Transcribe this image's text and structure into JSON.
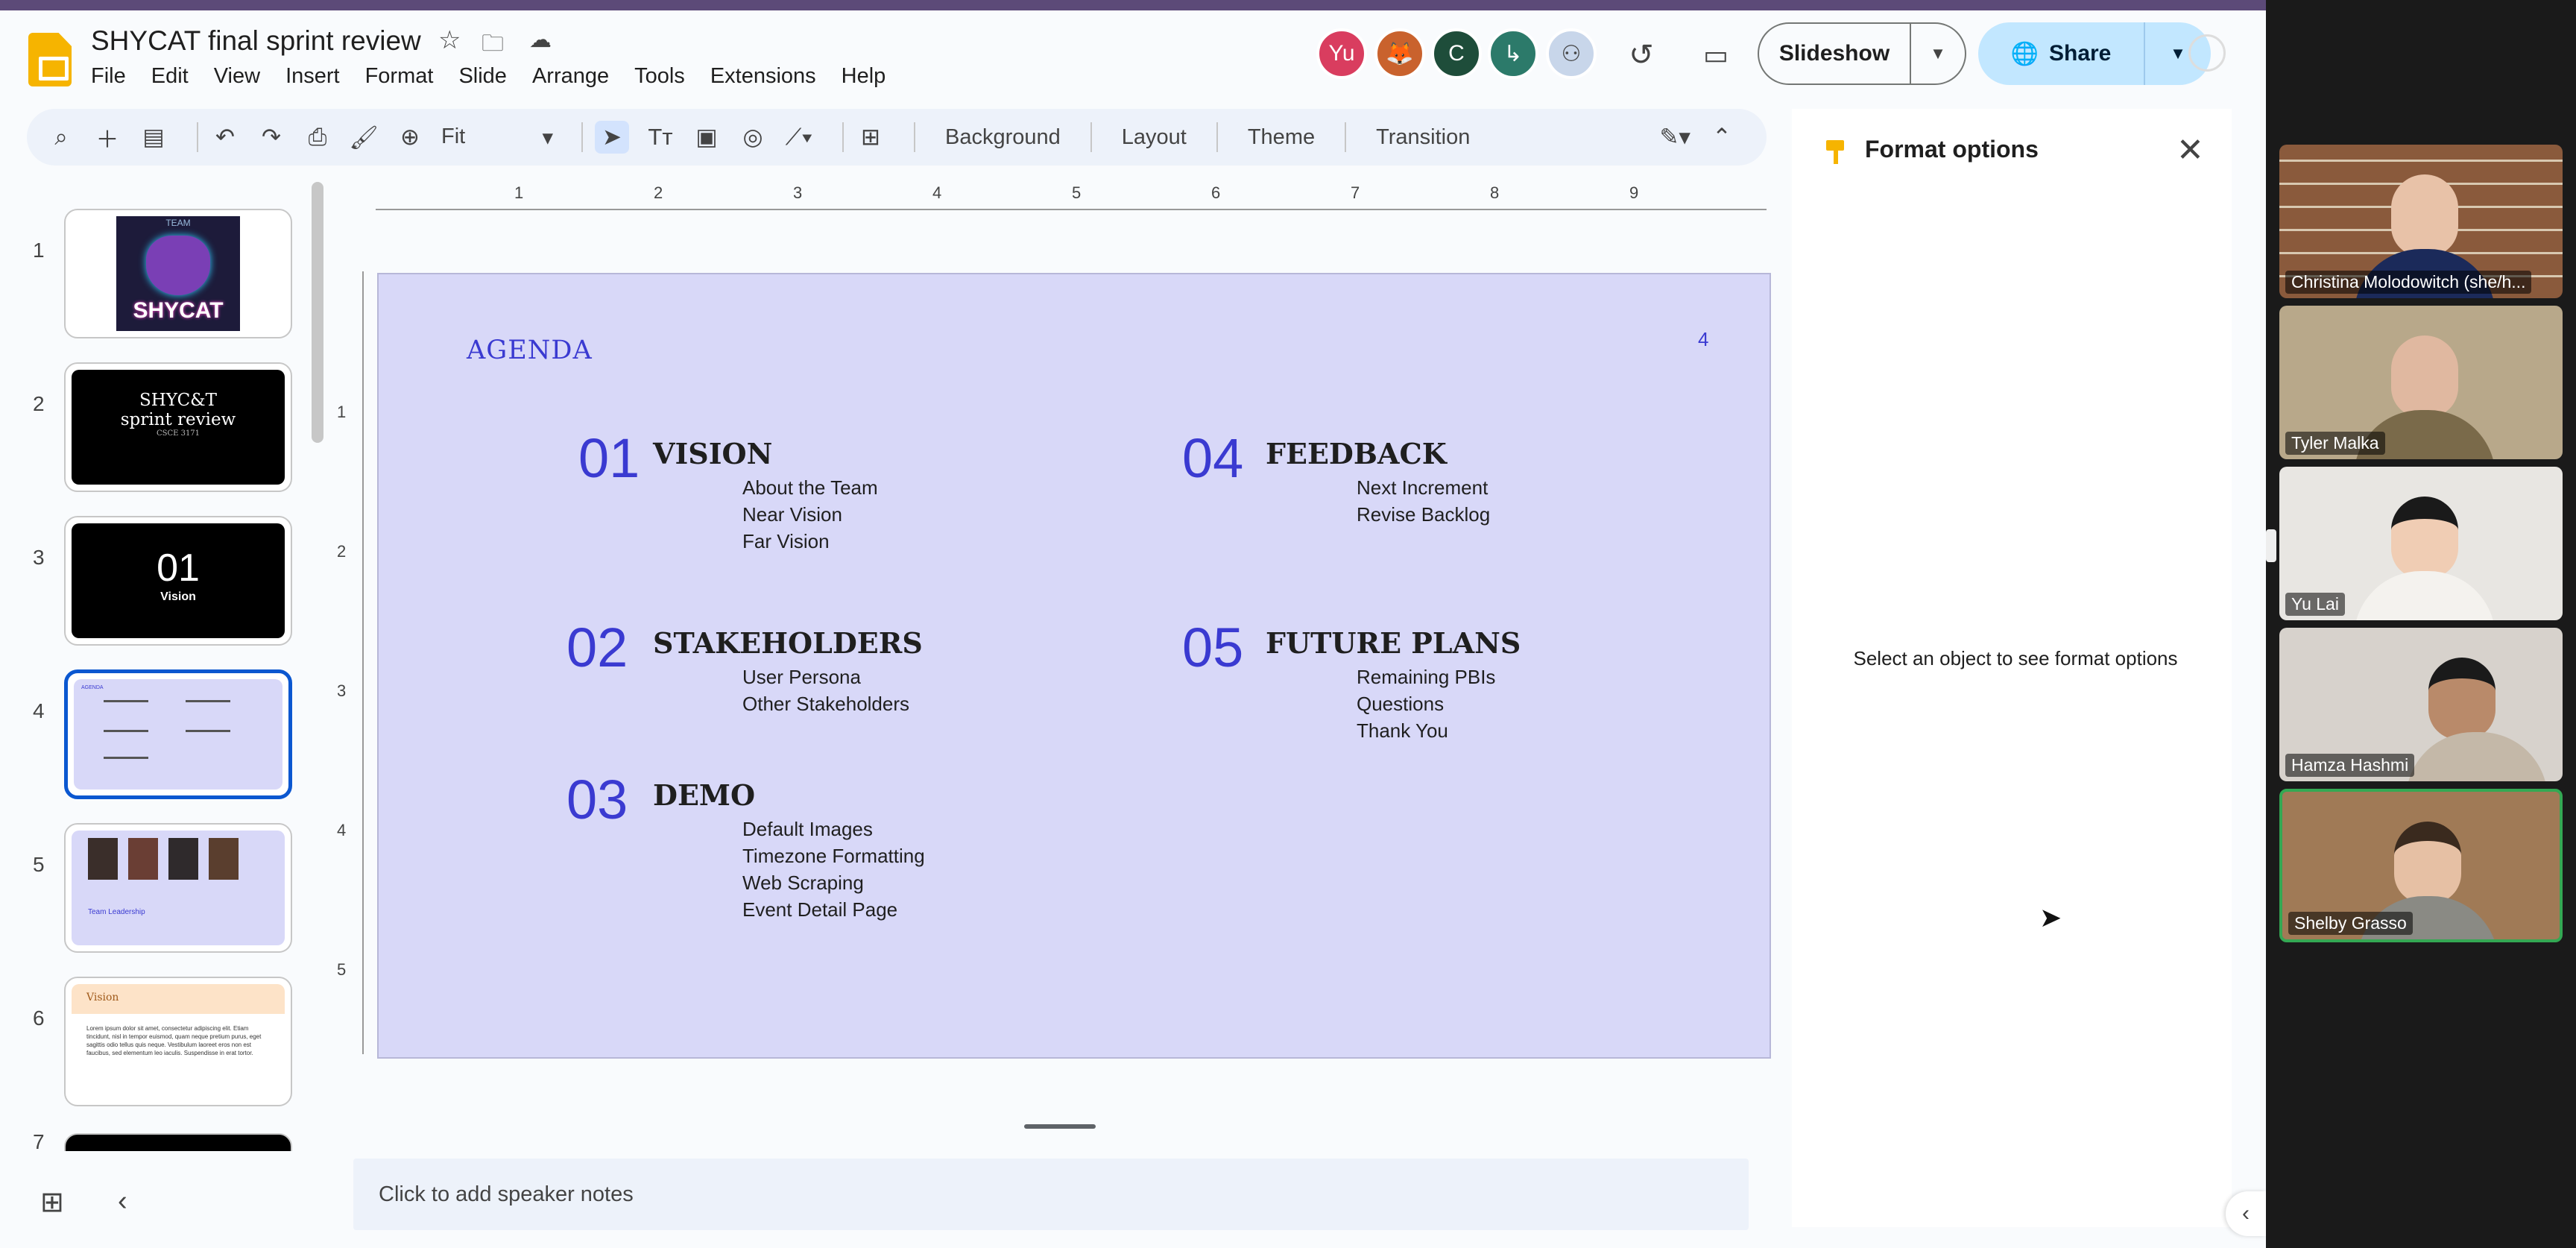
{
  "doc": {
    "title": "SHYCAT final sprint review",
    "menu": [
      "File",
      "Edit",
      "View",
      "Insert",
      "Format",
      "Slide",
      "Arrange",
      "Tools",
      "Extensions",
      "Help"
    ]
  },
  "header": {
    "collaborators": [
      {
        "initials": "Yu",
        "color": "#d93d5f"
      },
      {
        "initials": "",
        "color": "#c9622d"
      },
      {
        "initials": "C",
        "color": "#1e4d3a"
      },
      {
        "initials": "",
        "color": "#2c7a6a"
      },
      {
        "initials": "",
        "color": "#8aa7c9"
      }
    ],
    "slideshow_label": "Slideshow",
    "share_label": "Share"
  },
  "toolbar": {
    "zoom": "Fit",
    "background": "Background",
    "layout": "Layout",
    "theme": "Theme",
    "transition": "Transition"
  },
  "filmstrip": {
    "numbers": [
      "1",
      "2",
      "3",
      "4",
      "5",
      "6",
      "7"
    ],
    "slide1_team": "TEAM",
    "slide1_title": "SHYCAT",
    "slide2_title": "SHYC&T",
    "slide2_subtitle": "sprint review",
    "slide2_course": "CSCE 3171",
    "slide3_num": "01",
    "slide3_label": "Vision",
    "slide5_label": "Team Leadership",
    "slide6_title": "Vision",
    "slide6_body": "Lorem ipsum dolor sit amet, consectetur adipiscing elit. Etiam tincidunt, nisl in tempor euismod, quam neque pretium purus, eget sagittis odio tellus quis neque. Vestibulum laoreet eros non est faucibus, sed elementum leo iaculis. Suspendisse in erat tortor."
  },
  "ruler": {
    "h": [
      "1",
      "2",
      "3",
      "4",
      "5",
      "6",
      "7",
      "8",
      "9"
    ],
    "v": [
      "1",
      "2",
      "3",
      "4",
      "5"
    ]
  },
  "slide": {
    "heading": "AGENDA",
    "page_number": "4",
    "sections": [
      {
        "num": "01",
        "title": "VISION",
        "items": [
          "About the Team",
          "Near Vision",
          "Far Vision"
        ]
      },
      {
        "num": "02",
        "title": "STAKEHOLDERS",
        "items": [
          "User Persona",
          "Other Stakeholders"
        ]
      },
      {
        "num": "03",
        "title": "DEMO",
        "items": [
          "Default Images",
          "Timezone Formatting",
          "Web Scraping",
          "Event Detail Page"
        ]
      },
      {
        "num": "04",
        "title": "FEEDBACK",
        "items": [
          "Next Increment",
          "Revise Backlog"
        ]
      },
      {
        "num": "05",
        "title": "FUTURE PLANS",
        "items": [
          "Remaining PBIs",
          "Questions",
          "Thank You"
        ]
      }
    ]
  },
  "notes": {
    "placeholder": "Click to add speaker notes"
  },
  "format_panel": {
    "title": "Format options",
    "message": "Select an object to see format options"
  },
  "participants": [
    {
      "name": "Christina Molodowitch (she/h...",
      "bg": "#8a5a3c"
    },
    {
      "name": "Tyler Malka",
      "bg": "#b8a88a"
    },
    {
      "name": "Yu Lai",
      "bg": "#e8e6e2"
    },
    {
      "name": "Hamza Hashmi",
      "bg": "#d7d2cc"
    },
    {
      "name": "Shelby Grasso",
      "bg": "#a07a56"
    }
  ]
}
